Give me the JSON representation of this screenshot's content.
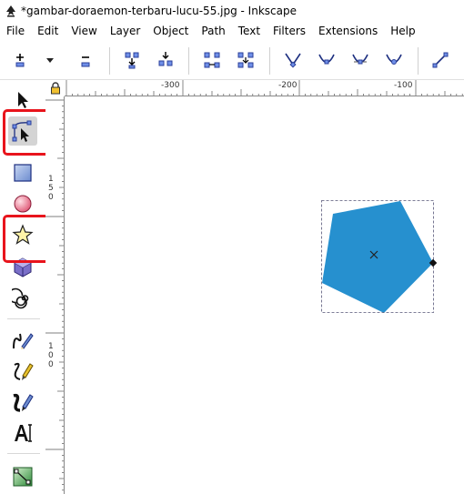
{
  "window": {
    "title": "*gambar-doraemon-terbaru-lucu-55.jpg - Inkscape",
    "app_icon": "inkscape-logo-icon"
  },
  "menu": {
    "items": [
      "File",
      "Edit",
      "View",
      "Layer",
      "Object",
      "Path",
      "Text",
      "Filters",
      "Extensions",
      "Help"
    ]
  },
  "tool_controls": {
    "icons": [
      "insert-node-icon",
      "dropdown-arrow-icon",
      "delete-node-icon",
      "join-nodes-icon",
      "break-path-icon",
      "join-segment-icon",
      "delete-segment-icon",
      "node-cusp-icon",
      "node-smooth-icon",
      "node-symmetric-icon",
      "node-auto-icon",
      "segment-line-icon"
    ]
  },
  "toolbox": {
    "tools": [
      {
        "name": "selector-tool",
        "icon": "arrow-icon",
        "active": false
      },
      {
        "name": "node-tool",
        "icon": "node-edit-icon",
        "active": true
      },
      {
        "name": "rect-tool",
        "icon": "square-icon",
        "active": false
      },
      {
        "name": "ellipse-tool",
        "icon": "circle-icon",
        "active": false
      },
      {
        "name": "star-tool",
        "icon": "star-icon",
        "active": false
      },
      {
        "name": "3dbox-tool",
        "icon": "cube-icon",
        "active": false
      },
      {
        "name": "spiral-tool",
        "icon": "spiral-icon",
        "active": false
      },
      {
        "name": "pencil-tool",
        "icon": "pencil-icon",
        "active": false
      },
      {
        "name": "pen-tool",
        "icon": "pen-icon",
        "active": false
      },
      {
        "name": "calligraphy-tool",
        "icon": "calligraphy-icon",
        "active": false
      },
      {
        "name": "text-tool",
        "icon": "text-icon",
        "active": false
      },
      {
        "name": "gradient-tool",
        "icon": "gradient-icon",
        "active": false
      }
    ],
    "highlight_color": "#e8141c"
  },
  "rulers": {
    "horizontal_labels": [
      "-300",
      "-200",
      "-100"
    ],
    "vertical_labels": [
      "1",
      "5",
      "0",
      "1",
      "0",
      "0"
    ]
  },
  "canvas": {
    "shape": "pentagon",
    "fill_color": "#2690cf",
    "selection_color": "#555577"
  }
}
